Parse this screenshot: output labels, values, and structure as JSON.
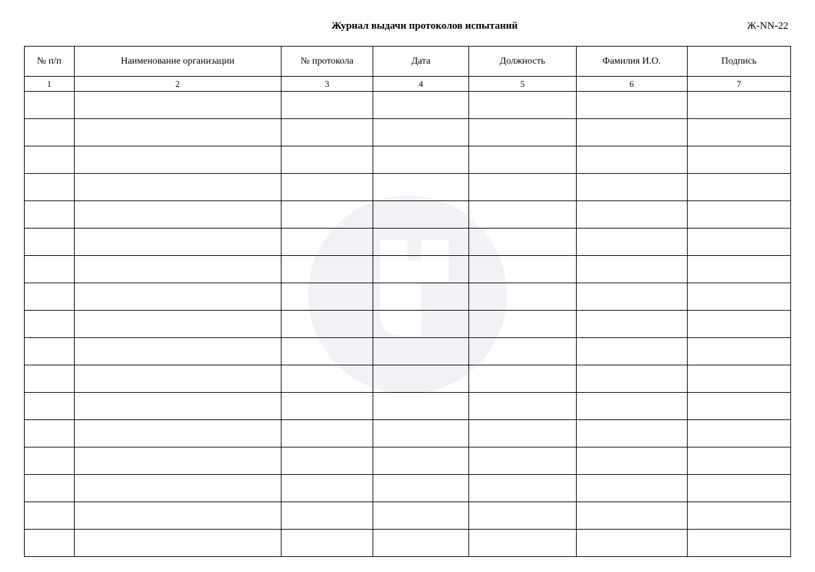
{
  "header": {
    "title": "Журнал выдачи протоколов испытаний",
    "doc_code": "Ж-NN-22"
  },
  "table": {
    "columns": [
      "№ п/п",
      "Наименование организации",
      "№ протокола",
      "Дата",
      "Должность",
      "Фамилия И.О.",
      "Подпись"
    ],
    "column_numbers": [
      "1",
      "2",
      "3",
      "4",
      "5",
      "6",
      "7"
    ],
    "empty_rows": 17
  }
}
